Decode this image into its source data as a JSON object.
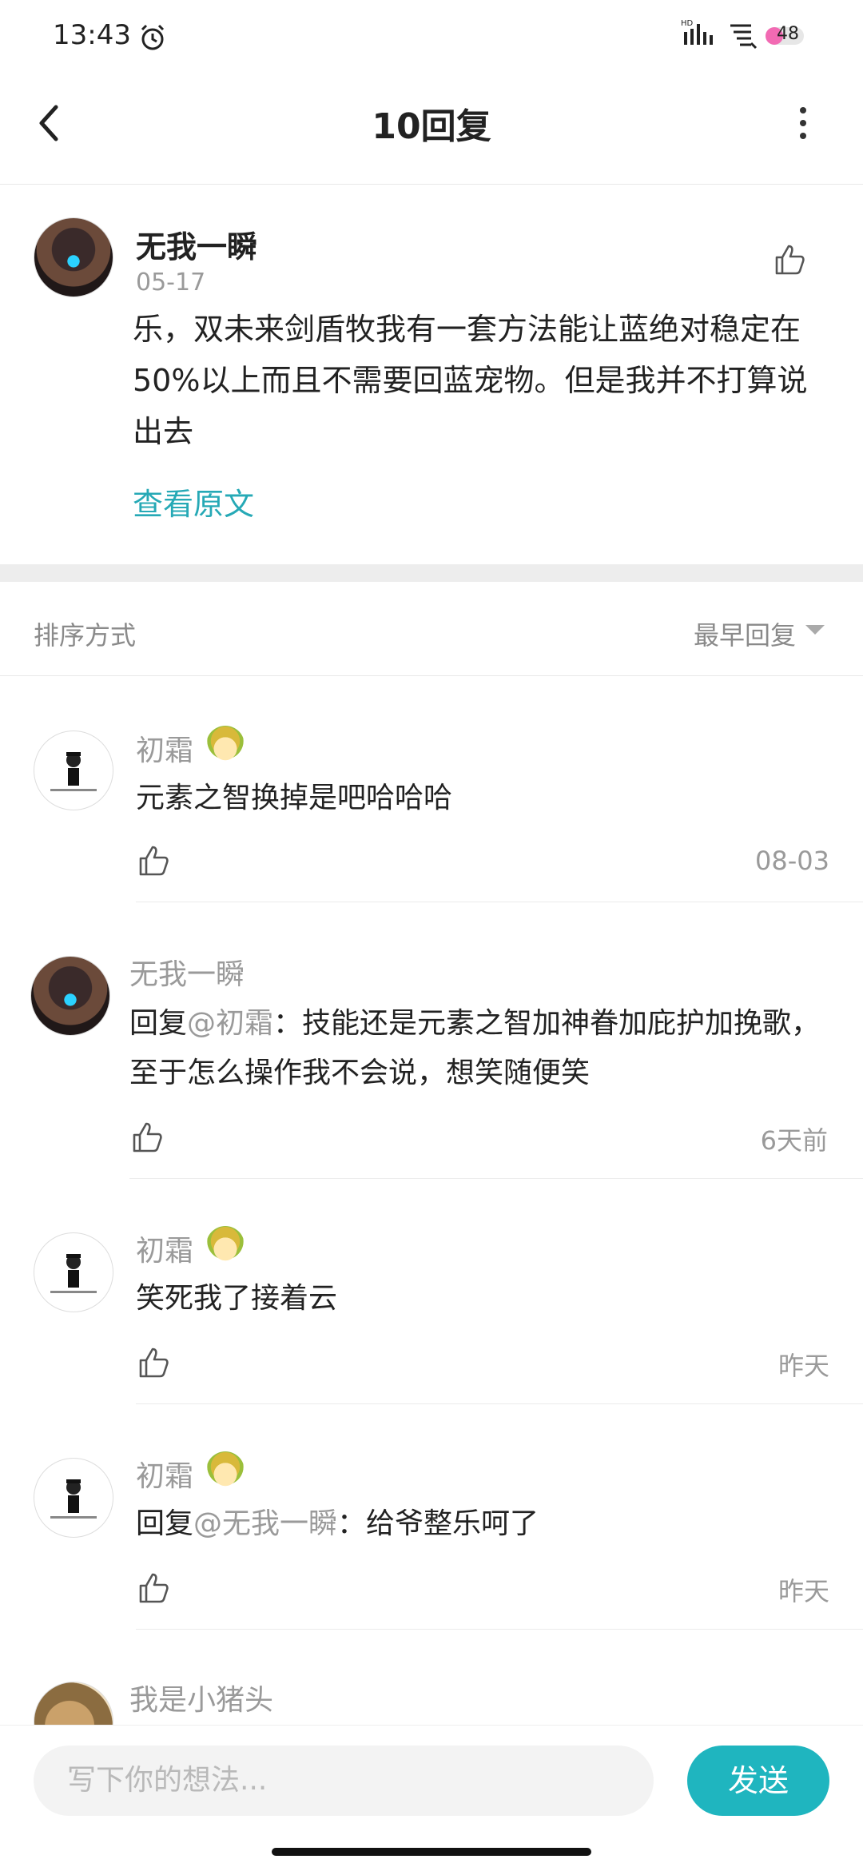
{
  "status_bar": {
    "time": "13:43",
    "battery": "48"
  },
  "header": {
    "title": "10回复"
  },
  "original_post": {
    "author": "无我一瞬",
    "date": "05-17",
    "text": "乐，双未来剑盾牧我有一套方法能让蓝绝对稳定在50%以上而且不需要回蓝宠物。但是我并不打算说出去",
    "view_original": "查看原文"
  },
  "sort": {
    "label": "排序方式",
    "value": "最早回复"
  },
  "comments": [
    {
      "name": "初霜",
      "text": "元素之智换掉是吧哈哈哈",
      "time": "08-03"
    },
    {
      "name": "无我一瞬",
      "reply_prefix": "回复",
      "mention": "@初霜",
      "text": "：技能还是元素之智加神眷加庇护加挽歌，至于怎么操作我不会说，想笑随便笑",
      "time": "6天前"
    },
    {
      "name": "初霜",
      "text": "笑死我了接着云",
      "time": "昨天"
    },
    {
      "name": "初霜",
      "reply_prefix": "回复",
      "mention": "@无我一瞬",
      "text": "：给爷整乐呵了",
      "time": "昨天"
    },
    {
      "name": "我是小猪头"
    }
  ],
  "composer": {
    "placeholder": "写下你的想法...",
    "send_label": "发送"
  }
}
